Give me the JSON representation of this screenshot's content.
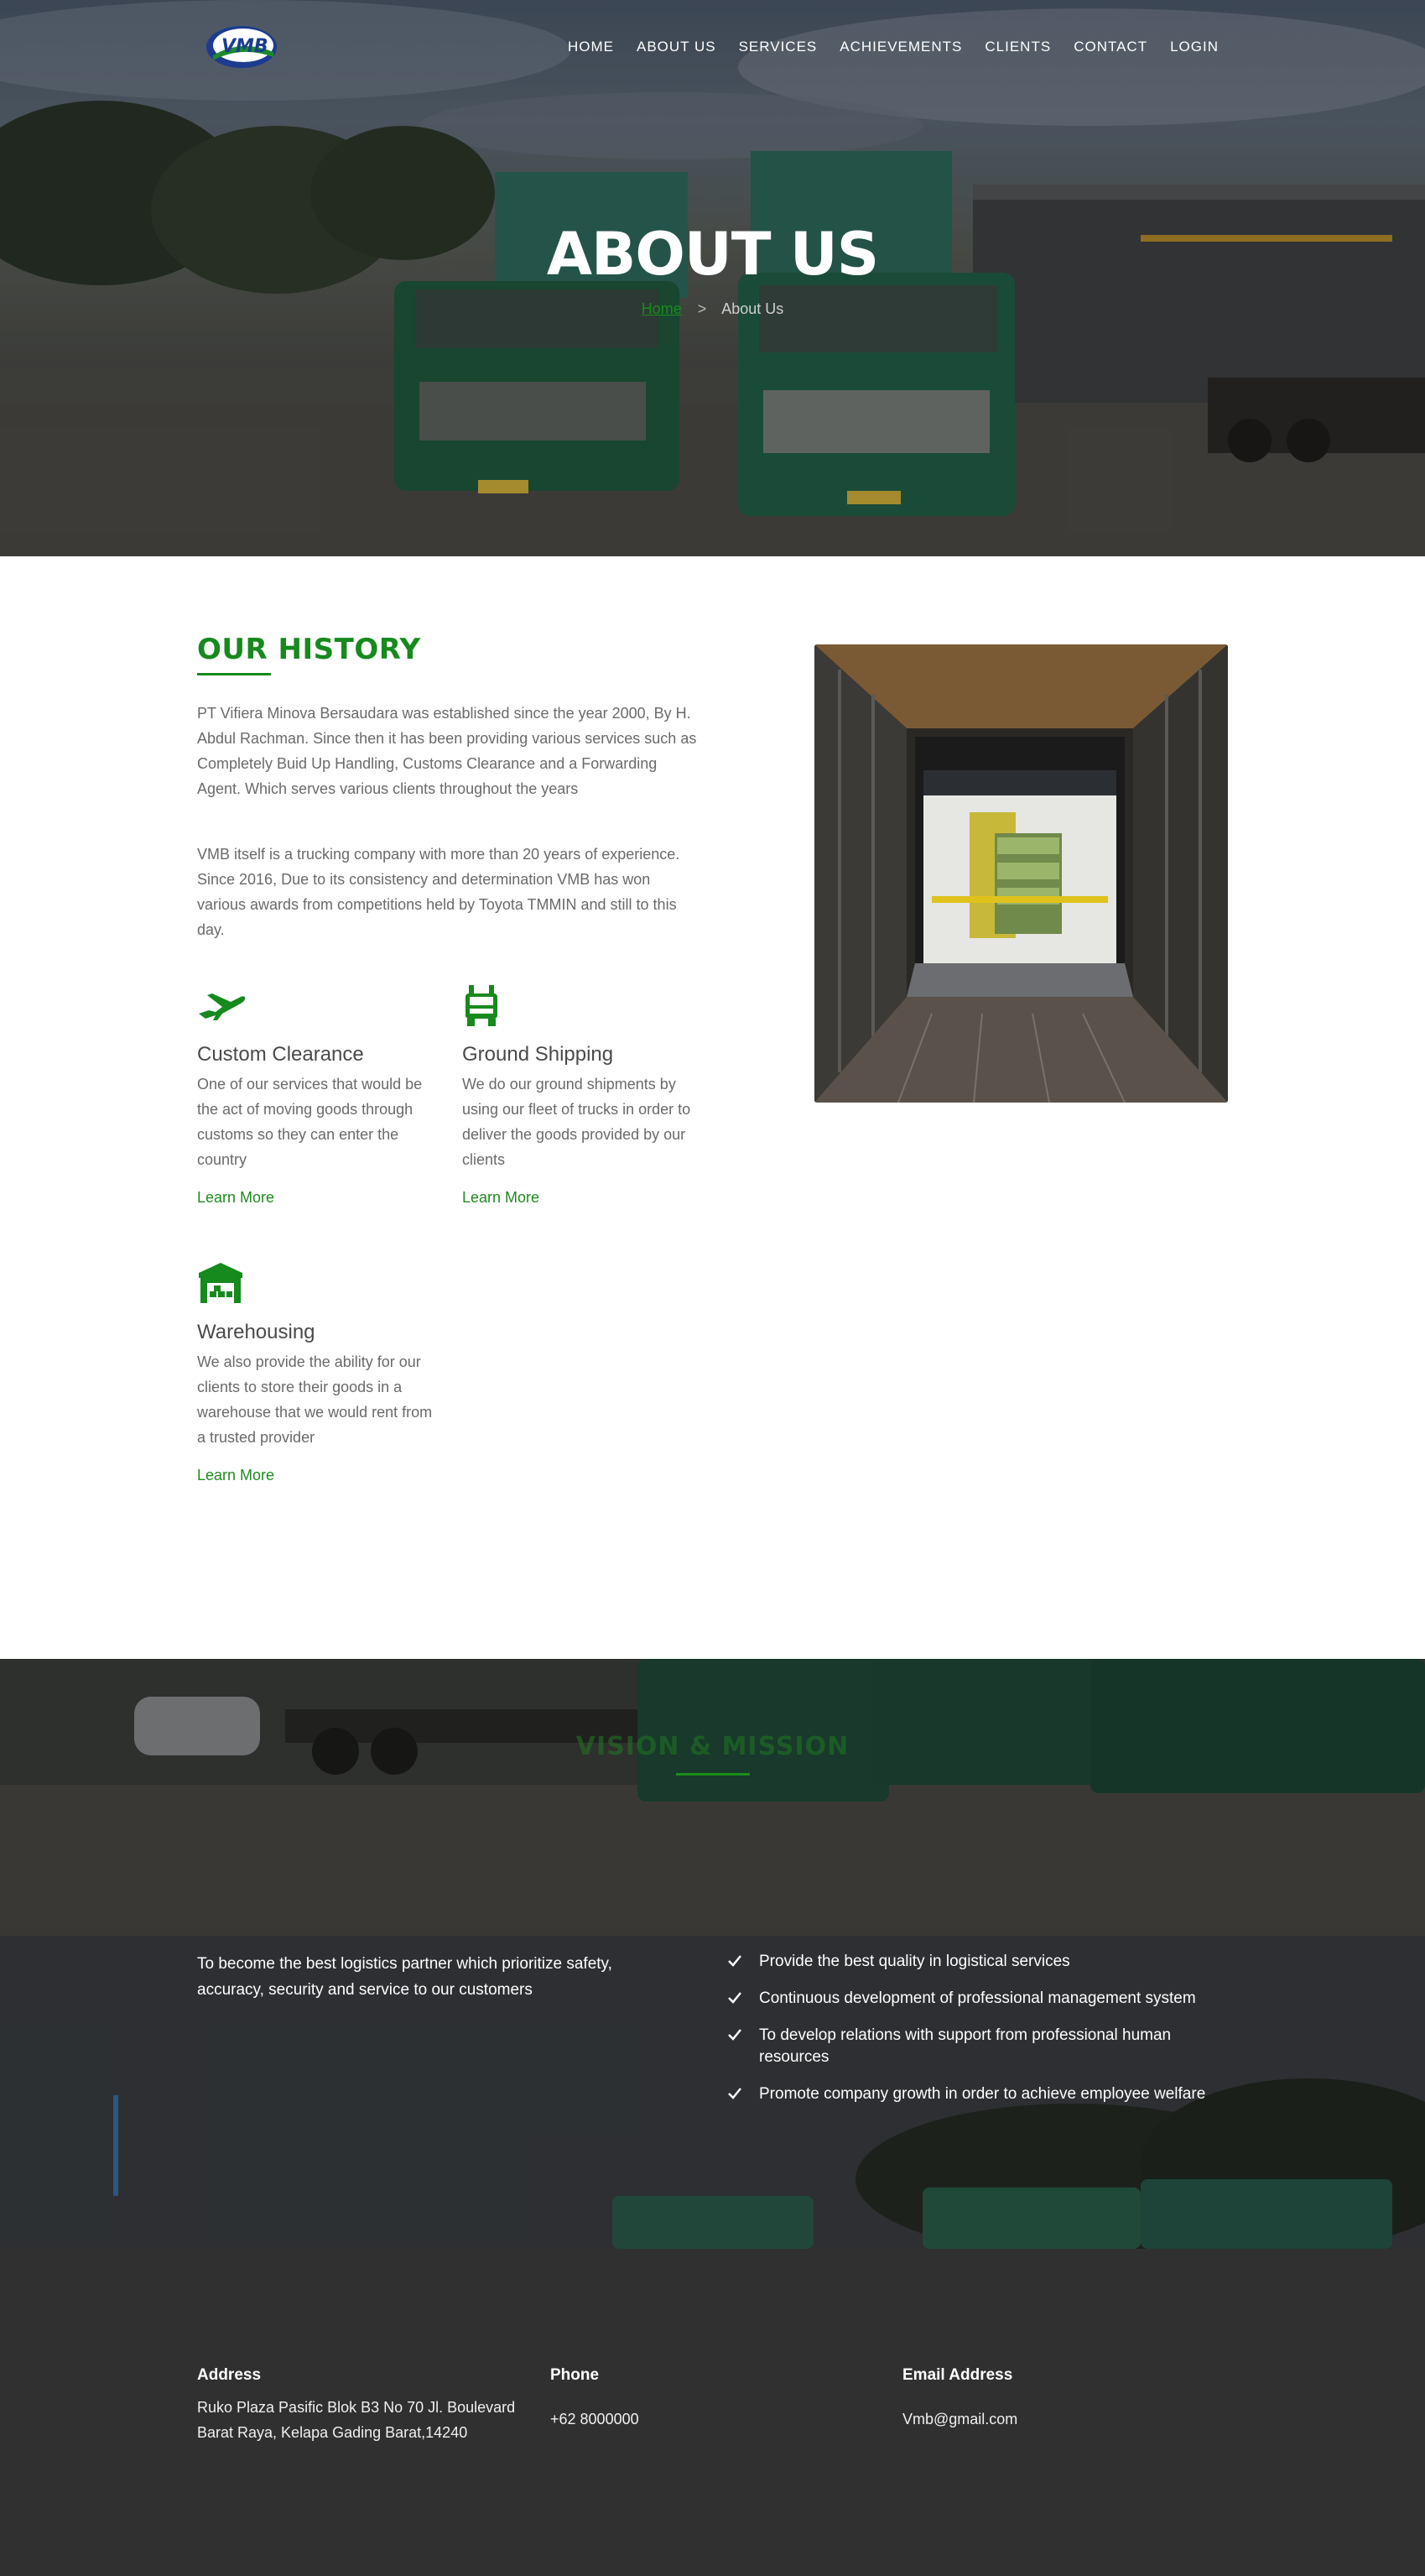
{
  "nav": {
    "items": [
      {
        "label": "HOME"
      },
      {
        "label": "ABOUT US"
      },
      {
        "label": "SERVICES"
      },
      {
        "label": "ACHIEVEMENTS"
      },
      {
        "label": "CLIENTS"
      },
      {
        "label": "CONTACT"
      },
      {
        "label": "LOGIN"
      }
    ]
  },
  "hero": {
    "title": "ABOUT US",
    "breadcrumb_home": "Home",
    "breadcrumb_separator": ">",
    "breadcrumb_current": "About Us"
  },
  "history": {
    "title": "OUR HISTORY",
    "paragraph1": "PT Vifiera Minova Bersaudara was established since the year 2000, By H. Abdul Rachman. Since then it has been providing various services such as Completely Buid Up Handling, Customs Clearance and a Forwarding Agent. Which serves various clients throughout the years",
    "paragraph2": "VMB itself is a trucking company with more than 20 years of experience. Since 2016, Due to its consistency and determination VMB has won various awards from competitions held by Toyota TMMIN and still to this day."
  },
  "services": [
    {
      "icon": "airplane-icon",
      "title": "Custom Clearance",
      "description": "One of our services that would be the act of moving goods through customs so they can enter the country",
      "link": "Learn More"
    },
    {
      "icon": "truck-icon",
      "title": "Ground Shipping",
      "description": "We do our ground shipments by using our fleet of trucks in order to deliver the goods provided by our clients",
      "link": "Learn More"
    },
    {
      "icon": "warehouse-icon",
      "title": "Warehousing",
      "description": "We also provide the ability for our clients to store their goods in a warehouse that we would rent from a trusted provider",
      "link": "Learn More"
    }
  ],
  "vision_mission": {
    "title": "VISION & MISSION",
    "vision": "To become the best logistics partner which prioritize safety, accuracy, security and service to our customers",
    "missions": [
      "Provide the best quality in logistical services",
      "Continuous development of professional management system",
      "To develop relations with support from professional human resources",
      "Promote company growth in order to achieve employee welfare"
    ]
  },
  "footer": {
    "address_label": "Address",
    "address": "Ruko Plaza Pasific Blok B3 No 70 Jl. Boulevard Barat Raya, Kelapa Gading Barat,14240",
    "phone_label": "Phone",
    "phone": "+62 8000000",
    "email_label": "Email Address",
    "email": "Vmb@gmail.com"
  },
  "colors": {
    "brand_green": "#168a1d",
    "footer_bg": "#303030",
    "hero_text": "#ffffff"
  }
}
